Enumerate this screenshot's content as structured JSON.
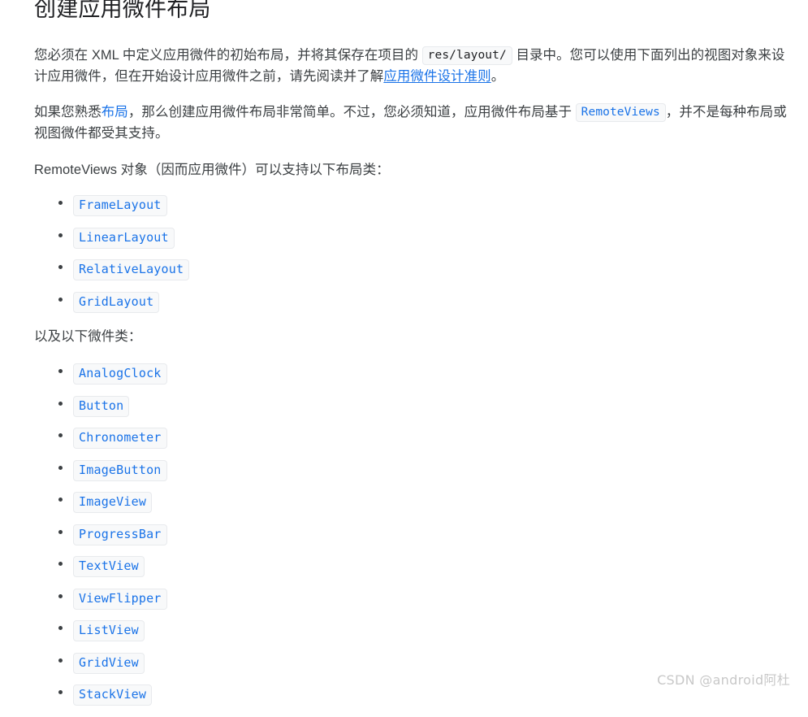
{
  "page": {
    "background_color": "#ffffff",
    "text_color": "#3c4043",
    "link_color": "#1a73e8",
    "chip_background": "#f8f9fa",
    "chip_border": "#e8eaed"
  },
  "heading": "创建应用微件布局",
  "paragraphs": {
    "p1": {
      "seg1": "您必须在 XML 中定义应用微件的初始布局，并将其保存在项目的 ",
      "code1": "res/layout/",
      "seg2": " 目录中。您可以使用下面列出的视图对象来设计应用微件，但在开始设计应用微件之前，请先阅读并了解",
      "link1": "应用微件设计准则",
      "seg3": "。"
    },
    "p2": {
      "seg1": "如果您熟悉",
      "link1": "布局",
      "seg2": "，那么创建应用微件布局非常简单。不过，您必须知道，应用微件布局基于 ",
      "code1": "RemoteViews",
      "seg3": "，并不是每种布局或视图微件都受其支持。"
    },
    "p3": "RemoteViews 对象（因而应用微件）可以支持以下布局类：",
    "p4": "以及以下微件类："
  },
  "layout_classes": [
    "FrameLayout",
    "LinearLayout",
    "RelativeLayout",
    "GridLayout"
  ],
  "widget_classes": [
    "AnalogClock",
    "Button",
    "Chronometer",
    "ImageButton",
    "ImageView",
    "ProgressBar",
    "TextView",
    "ViewFlipper",
    "ListView",
    "GridView",
    "StackView"
  ],
  "watermark": "CSDN @android阿杜"
}
